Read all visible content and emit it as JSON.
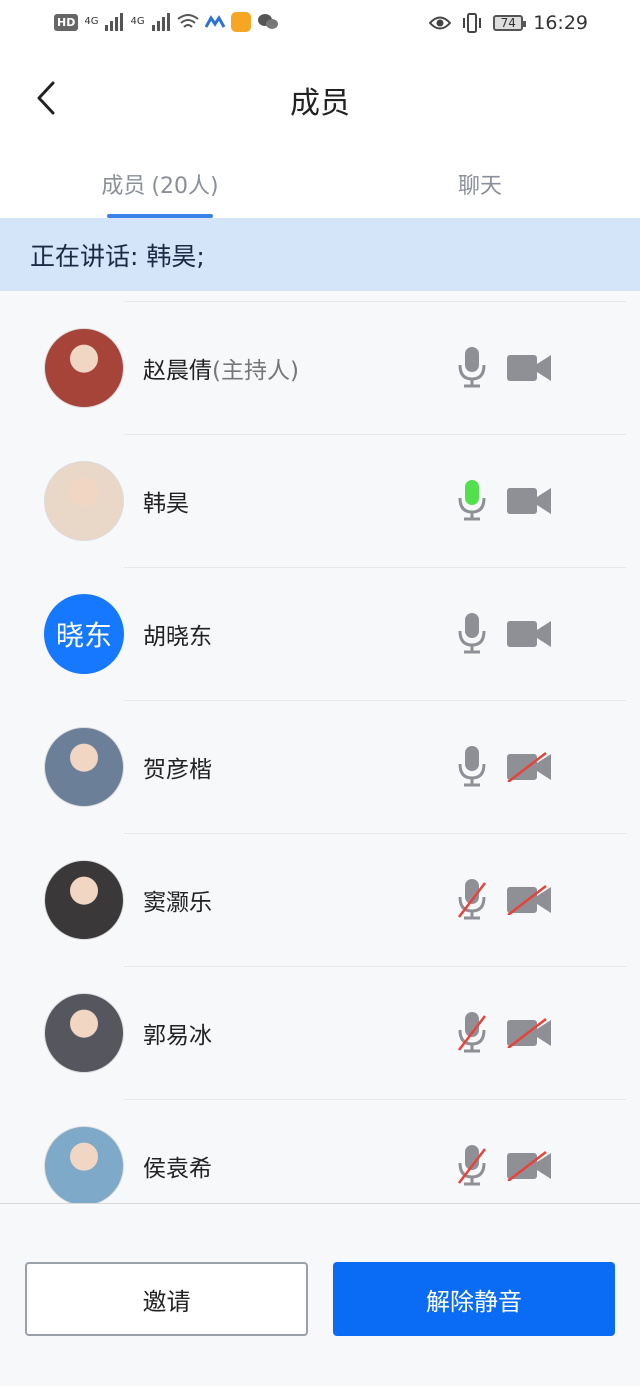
{
  "status_bar": {
    "hd": "HD",
    "net1": "4G",
    "net2": "4G",
    "battery": "74",
    "time": "16:29"
  },
  "header": {
    "title": "成员"
  },
  "tabs": [
    {
      "label": "成员",
      "count": "(20人)",
      "active": true
    },
    {
      "label": "聊天",
      "active": false
    }
  ],
  "speaking": {
    "text": "正在讲话: 韩昊;"
  },
  "members": [
    {
      "name": "赵晨倩",
      "role": "(主持人)",
      "avatar": "photo",
      "avatar_color": "#a6443a",
      "mic": "on",
      "cam": "on"
    },
    {
      "name": "韩昊",
      "role": "",
      "avatar": "photo",
      "avatar_color": "#e9d8c8",
      "mic": "speaking",
      "cam": "on"
    },
    {
      "name": "胡晓东",
      "role": "",
      "avatar": "text",
      "avatar_text": "晓东",
      "mic": "on",
      "cam": "on"
    },
    {
      "name": "贺彦楷",
      "role": "",
      "avatar": "photo",
      "avatar_color": "#6c7f99",
      "mic": "on",
      "cam": "off"
    },
    {
      "name": "窦灏乐",
      "role": "",
      "avatar": "photo",
      "avatar_color": "#3a3838",
      "mic": "off",
      "cam": "off"
    },
    {
      "name": "郭易冰",
      "role": "",
      "avatar": "photo",
      "avatar_color": "#56565e",
      "mic": "off",
      "cam": "off"
    },
    {
      "name": "侯袁希",
      "role": "",
      "avatar": "photo",
      "avatar_color": "#7ea9c9",
      "mic": "off",
      "cam": "off"
    }
  ],
  "actions": {
    "invite": "邀请",
    "unmute": "解除静音"
  },
  "colors": {
    "accent": "#0a6cf5",
    "tab_indicator": "#3a82e8",
    "speaking_bg": "#d4e5fa",
    "icon_gray": "#8e9096",
    "mic_active": "#52e04d",
    "muted_slash": "#e8423a"
  }
}
